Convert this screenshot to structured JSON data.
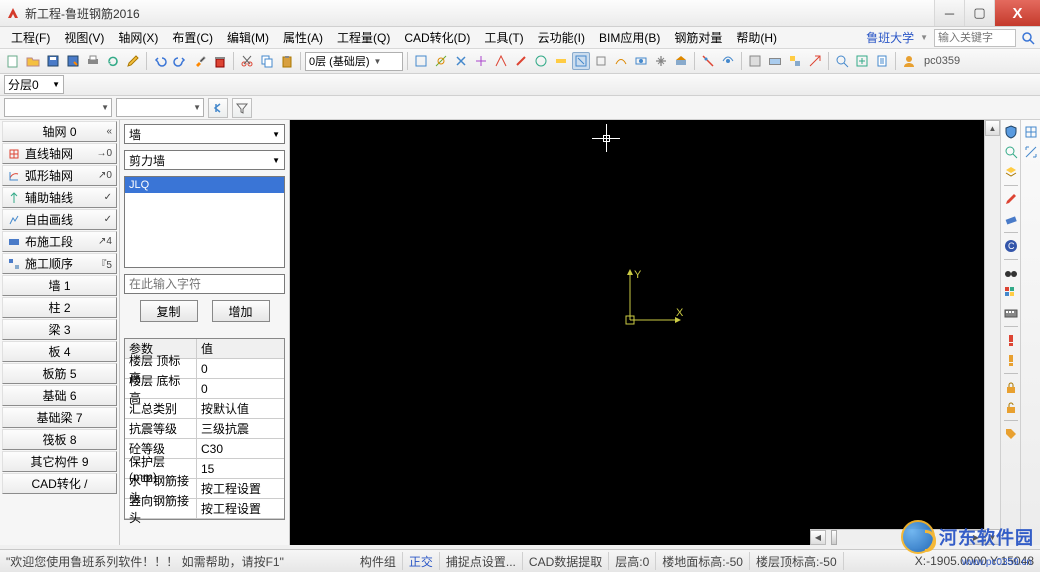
{
  "title": "新工程-鲁班钢筋2016",
  "menu": [
    "工程(F)",
    "视图(V)",
    "轴网(X)",
    "布置(C)",
    "编辑(M)",
    "属性(A)",
    "工程量(Q)",
    "CAD转化(D)",
    "工具(T)",
    "云功能(I)",
    "BIM应用(B)",
    "钢筋对量",
    "帮助(H)"
  ],
  "menu_right": {
    "univ": "鲁班大学",
    "search_placeholder": "输入关键字"
  },
  "toolbar_layer": "0层 (基础层)",
  "pc_user": "pc0359",
  "floor_drop": "分层0",
  "sidebar": {
    "items_top": [
      {
        "label": "轴网 0",
        "arrow": "«"
      },
      {
        "label": "直线轴网",
        "arrow": "→0",
        "icon": "grid"
      },
      {
        "label": "弧形轴网",
        "arrow": "↗0",
        "icon": "arc"
      },
      {
        "label": "辅助轴线",
        "arrow": "✓",
        "icon": "aux"
      },
      {
        "label": "自由画线",
        "arrow": "✓",
        "icon": "free"
      },
      {
        "label": "布施工段",
        "arrow": "↗4",
        "icon": "stage"
      },
      {
        "label": "施工顺序",
        "arrow": "『5",
        "icon": "order"
      }
    ],
    "items_bottom": [
      {
        "label": "墙 1"
      },
      {
        "label": "柱 2"
      },
      {
        "label": "梁 3"
      },
      {
        "label": "板 4"
      },
      {
        "label": "板筋 5"
      },
      {
        "label": "基础 6"
      },
      {
        "label": "基础梁 7"
      },
      {
        "label": "筏板 8"
      },
      {
        "label": "其它构件 9"
      },
      {
        "label": "CAD转化 /"
      }
    ]
  },
  "prop": {
    "drop1": "墙",
    "drop2": "剪力墙",
    "list_item": "JLQ",
    "input_placeholder": "在此输入字符",
    "btn_copy": "复制",
    "btn_add": "增加",
    "table_header": [
      "参数",
      "值"
    ],
    "rows": [
      [
        "楼层 顶标高",
        "0"
      ],
      [
        "楼层 底标高",
        "0"
      ],
      [
        "汇总类别",
        "按默认值"
      ],
      [
        "抗震等级",
        "三级抗震"
      ],
      [
        "砼等级",
        "C30"
      ],
      [
        "保护层(mm)",
        "15"
      ],
      [
        "水平钢筋接头",
        "按工程设置"
      ],
      [
        "竖向钢筋接头",
        "按工程设置"
      ]
    ]
  },
  "axis": {
    "x": "X",
    "y": "Y"
  },
  "status": {
    "welcome": "\"欢迎您使用鲁班系列软件！！！ 如需帮助，请按F1\"",
    "segs": [
      "构件组",
      "正交",
      "捕捉点设置...",
      "CAD数据提取",
      "层高:0",
      "楼地面标高:-50",
      "楼层顶标高:-50"
    ],
    "coords": "X:-1905.0000 Y:15048"
  },
  "watermark": {
    "text": "河东软件园",
    "url": "www.pc0359.cn"
  }
}
